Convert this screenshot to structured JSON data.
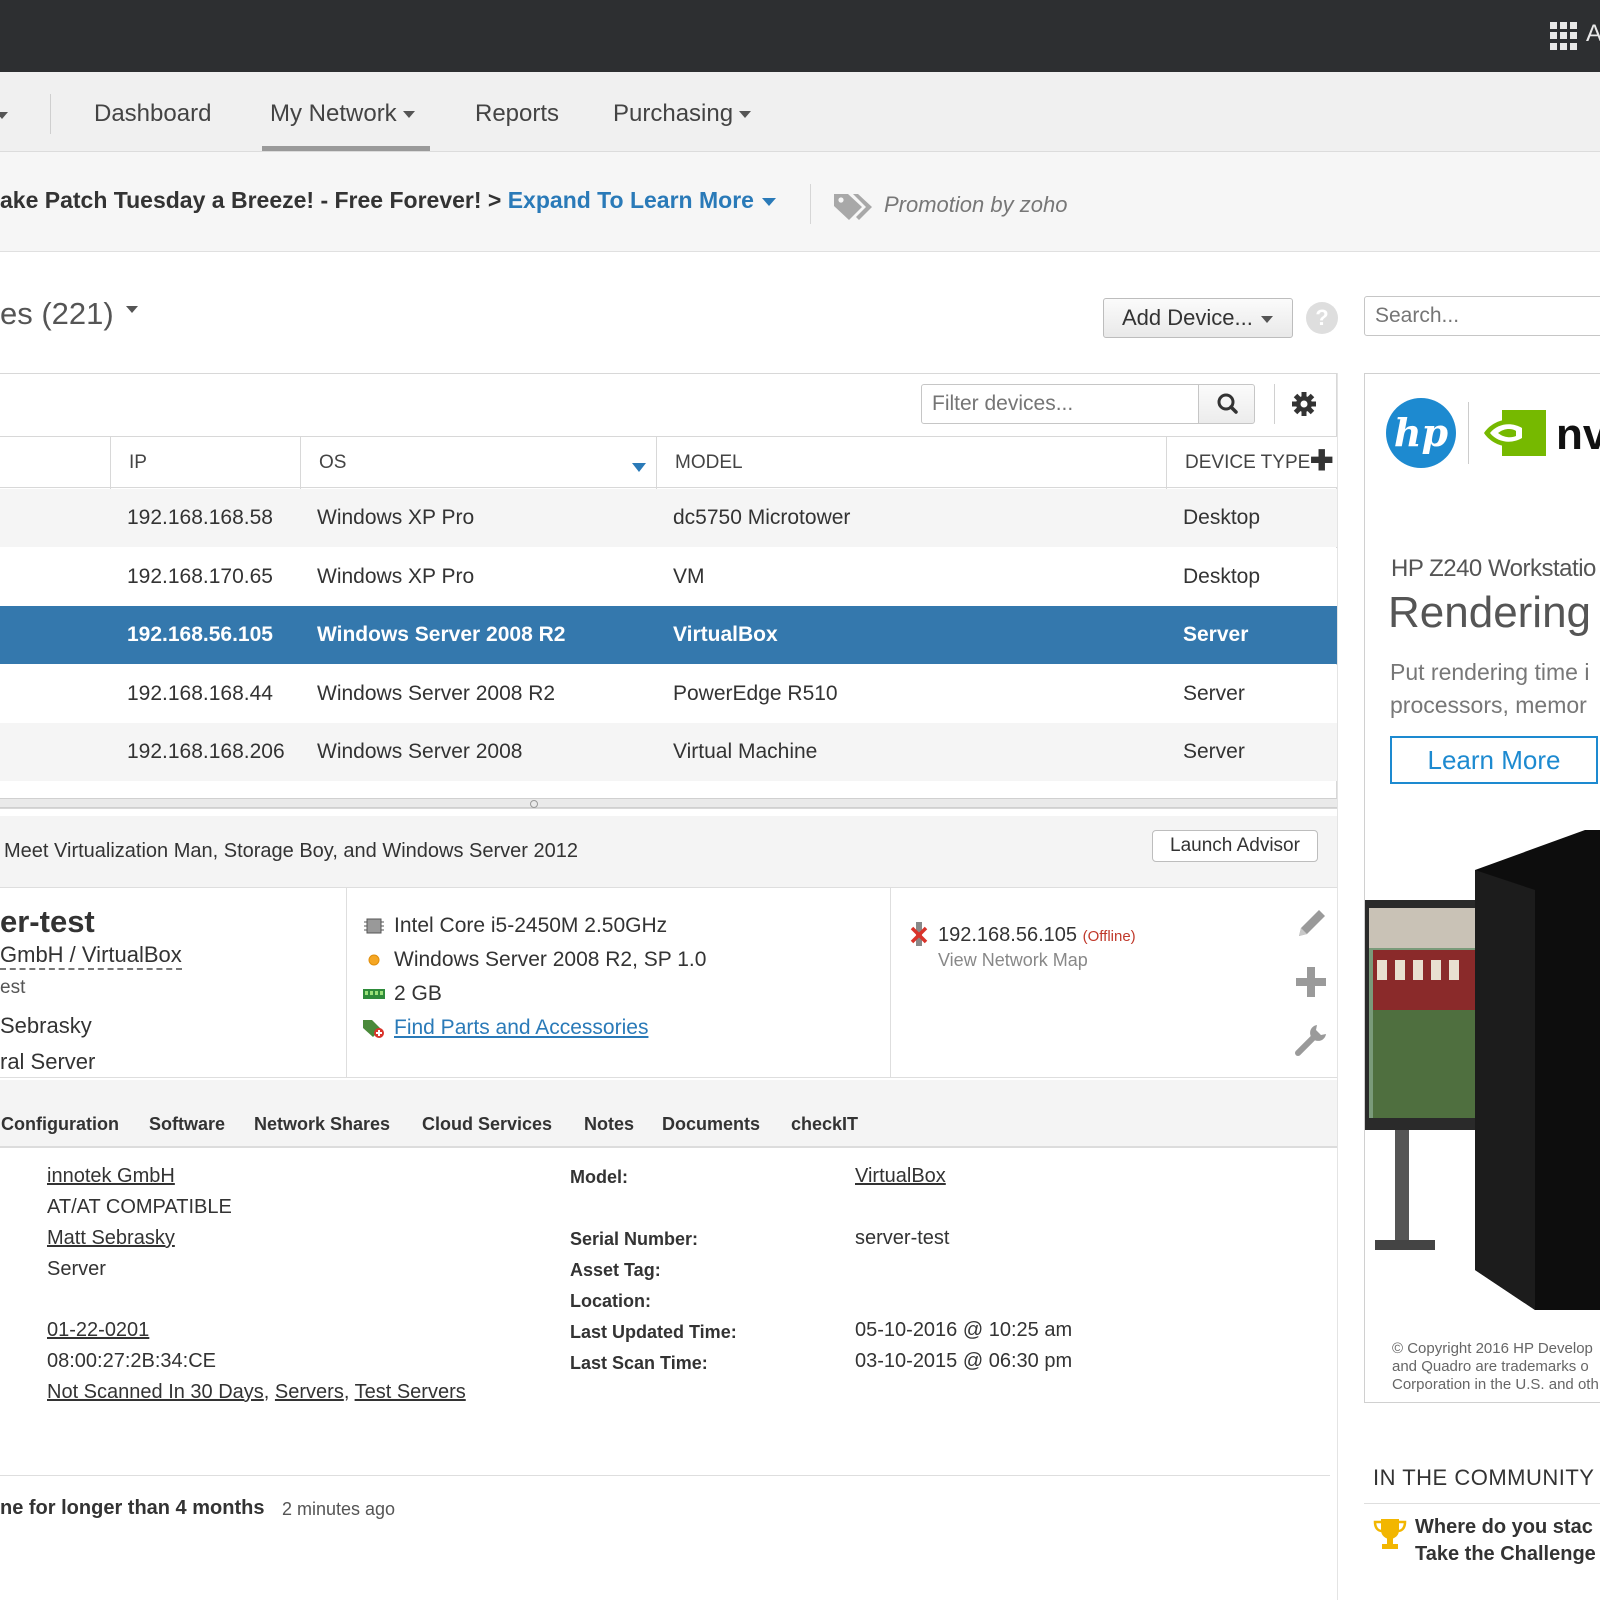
{
  "topbar": {
    "user_initial": "A"
  },
  "nav": {
    "items": [
      {
        "label": "Dashboard"
      },
      {
        "label": "My Network"
      },
      {
        "label": "Reports"
      },
      {
        "label": "Purchasing"
      }
    ],
    "active": "My Network"
  },
  "promo": {
    "text": "ake Patch Tuesday a Breeze! - Free Forever! > ",
    "link": "Expand To Learn More",
    "by": "Promotion by zoho"
  },
  "devices": {
    "title": "es (221)",
    "add_device": "Add Device...",
    "help": "?",
    "search_placeholder": "Search...",
    "filter_placeholder": "Filter devices...",
    "columns": [
      "IP",
      "OS",
      "MODEL",
      "DEVICE TYPE"
    ],
    "rows": [
      {
        "ip": "192.168.168.58",
        "os": "Windows XP Pro",
        "model": "dc5750 Microtower",
        "type": "Desktop"
      },
      {
        "ip": "192.168.170.65",
        "os": "Windows XP Pro",
        "model": "VM",
        "type": "Desktop"
      },
      {
        "ip": "192.168.56.105",
        "os": "Windows Server 2008 R2",
        "model": "VirtualBox",
        "type": "Server"
      },
      {
        "ip": "192.168.168.44",
        "os": "Windows Server 2008 R2",
        "model": "PowerEdge R510",
        "type": "Server"
      },
      {
        "ip": "192.168.168.206",
        "os": "Windows Server 2008",
        "model": "Virtual Machine",
        "type": "Server"
      }
    ],
    "selected_row": 2
  },
  "advisor": {
    "text": "Meet Virtualization Man, Storage Boy, and Windows Server 2012",
    "button": "Launch Advisor"
  },
  "detail": {
    "name": "er-test",
    "vendor_model": "GmbH / VirtualBox",
    "small": "est",
    "owner": "Sebrasky",
    "role": "ral Server",
    "cpu": "Intel Core i5-2450M 2.50GHz",
    "os": "Windows Server 2008 R2, SP 1.0",
    "memory": "2 GB",
    "parts_link": "Find Parts and Accessories",
    "ip": "192.168.56.105",
    "status": "(Offline)",
    "network_map": "View Network Map"
  },
  "tabs": [
    "Configuration",
    "Software",
    "Network Shares",
    "Cloud Services",
    "Notes",
    "Documents",
    "checkIT"
  ],
  "info": {
    "left": [
      "innotek GmbH",
      "AT/AT COMPATIBLE",
      "Matt Sebrasky",
      "Server",
      "01-22-0201",
      "08:00:27:2B:34:CE"
    ],
    "groups": [
      "Not Scanned In 30 Days",
      "Servers",
      "Test Servers"
    ],
    "labels": {
      "model": "Model:",
      "serial": "Serial Number:",
      "asset": "Asset Tag:",
      "location": "Location:",
      "updated": "Last Updated Time:",
      "scanned": "Last Scan Time:"
    },
    "values": {
      "model": "VirtualBox",
      "serial": "server-test",
      "updated": "05-10-2016 @ 10:25 am",
      "scanned": "03-10-2015 @ 06:30 pm"
    }
  },
  "alert": {
    "text": "ne for longer than 4 months",
    "time": "2 minutes ago"
  },
  "ad": {
    "hp_logo": "hp",
    "nvidia_text": "nv",
    "subtitle": "HP Z240 Workstatio",
    "headline": "Rendering s",
    "body1": "Put rendering time i",
    "body2": "processors, memor",
    "button": "Learn More",
    "copy1": "© Copyright 2016 HP Develop",
    "copy2": "and Quadro are trademarks o",
    "copy3": "Corporation in the U.S. and oth"
  },
  "community": {
    "title": "IN THE COMMUNITY",
    "item1": "Where do you stac",
    "item2": "Take the Challenge"
  },
  "colors": {
    "topbar": "#2d2f31",
    "selected_row": "#3478ad",
    "link": "#2a7ab8",
    "hp_blue": "#1d8ad0",
    "nvidia_green": "#76b900"
  }
}
